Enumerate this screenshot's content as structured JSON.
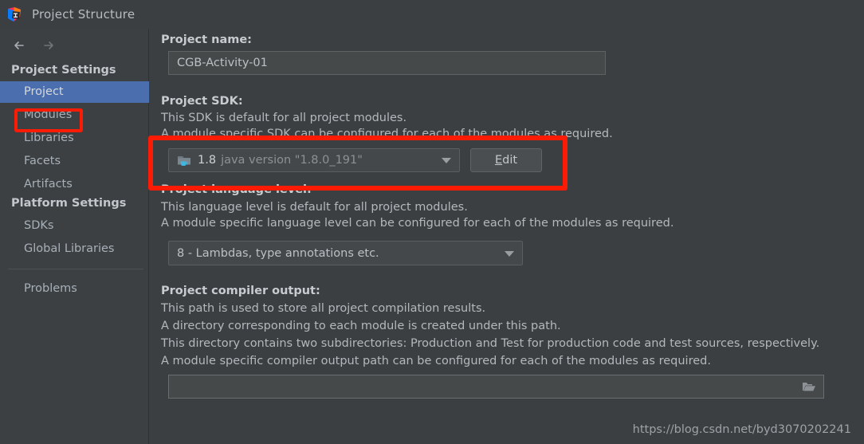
{
  "window": {
    "title": "Project Structure",
    "app_icon": "intellij-idea-icon"
  },
  "sidebar": {
    "nav": {
      "back_icon": "arrow-left-icon",
      "forward_icon": "arrow-right-icon"
    },
    "groups": [
      {
        "header": "Project Settings",
        "items": [
          {
            "label": "Project",
            "selected": true,
            "annotated": true
          },
          {
            "label": "Modules",
            "selected": false
          },
          {
            "label": "Libraries",
            "selected": false
          },
          {
            "label": "Facets",
            "selected": false
          },
          {
            "label": "Artifacts",
            "selected": false
          }
        ]
      },
      {
        "header": "Platform Settings",
        "items": [
          {
            "label": "SDKs",
            "selected": false
          },
          {
            "label": "Global Libraries",
            "selected": false
          }
        ]
      }
    ],
    "footer_items": [
      {
        "label": "Problems"
      }
    ]
  },
  "main": {
    "project_name": {
      "label": "Project name:",
      "value": "CGB-Activity-01"
    },
    "project_sdk": {
      "label": "Project SDK:",
      "description_line1": "This SDK is default for all project modules.",
      "description_line2": "A module specific SDK can be configured for each of the modules as required.",
      "icon": "jdk-folder-icon",
      "version": "1.8",
      "path": "java version \"1.8.0_191\"",
      "dropdown_icon": "chevron-down-icon",
      "edit_button": {
        "mnemonic": "E",
        "rest": "dit"
      }
    },
    "language_level": {
      "label": "Project language level:",
      "description_line1": "This language level is default for all project modules.",
      "description_line2": "A module specific language level can be configured for each of the modules as required.",
      "value": "8 - Lambdas, type annotations etc.",
      "dropdown_icon": "chevron-down-icon"
    },
    "compiler_output": {
      "label": "Project compiler output:",
      "description_line1": "This path is used to store all project compilation results.",
      "description_line2": "A directory corresponding to each module is created under this path.",
      "description_line3": "This directory contains two subdirectories: Production and Test for production code and test sources, respectively.",
      "description_line4": "A module specific compiler output path can be configured for each of the modules as required.",
      "value": "",
      "browse_icon": "folder-open-icon"
    }
  },
  "watermark": {
    "text": "https://blog.csdn.net/byd3070202241"
  },
  "colors": {
    "annotation": "#fc1b05",
    "selection": "#4b6eaf",
    "panel_bg": "#3c3f41",
    "sidebar_bg": "#3c4043"
  }
}
